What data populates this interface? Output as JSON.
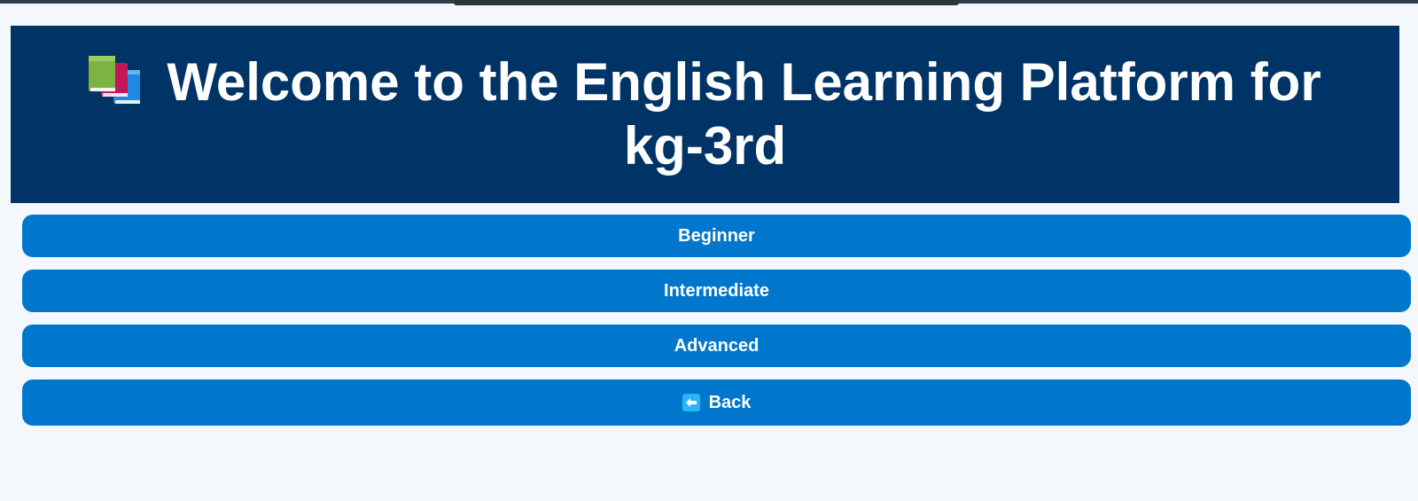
{
  "header": {
    "title": "Welcome to the English Learning Platform for kg-3rd",
    "icon": "books-icon"
  },
  "levels": [
    {
      "label": "Beginner"
    },
    {
      "label": "Intermediate"
    },
    {
      "label": "Advanced"
    }
  ],
  "back": {
    "label": "Back",
    "icon": "left-arrow-icon"
  },
  "colors": {
    "background": "#f4f7fb",
    "header_bg": "#003366",
    "button_bg": "#0077cc",
    "text": "#ffffff"
  }
}
